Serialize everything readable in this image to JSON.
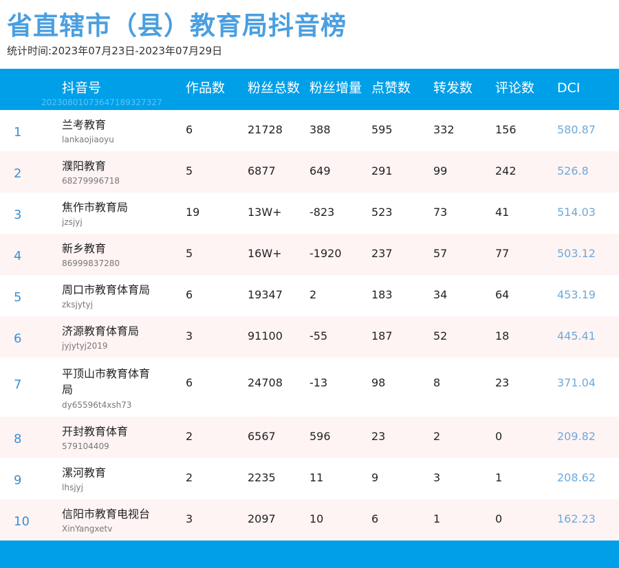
{
  "page": {
    "title": "省直辖市（县）教育局抖音榜",
    "period": "统计时间:2023年07月23日-2023年07月29日"
  },
  "table": {
    "headers": {
      "account": "抖音号",
      "works": "作品数",
      "fans_total": "粉丝总数",
      "fans_growth": "粉丝增量",
      "likes": "点赞数",
      "shares": "转发数",
      "comments": "评论数",
      "dci": "DCI"
    },
    "watermark": "20230801073647189327327",
    "rows": [
      {
        "rank": "1",
        "name": "兰考教育",
        "handle": "lankaojiaoyu",
        "works": "6",
        "fans": "21728",
        "growth": "388",
        "likes": "595",
        "shares": "332",
        "comments": "156",
        "dci": "580.87"
      },
      {
        "rank": "2",
        "name": "濮阳教育",
        "handle": "68279996718",
        "works": "5",
        "fans": "6877",
        "growth": "649",
        "likes": "291",
        "shares": "99",
        "comments": "242",
        "dci": "526.8"
      },
      {
        "rank": "3",
        "name": "焦作市教育局",
        "handle": "jzsjyj",
        "works": "19",
        "fans": "13W+",
        "growth": "-823",
        "likes": "523",
        "shares": "73",
        "comments": "41",
        "dci": "514.03"
      },
      {
        "rank": "4",
        "name": "新乡教育",
        "handle": "86999837280",
        "works": "5",
        "fans": "16W+",
        "growth": "-1920",
        "likes": "237",
        "shares": "57",
        "comments": "77",
        "dci": "503.12"
      },
      {
        "rank": "5",
        "name": "周口市教育体育局",
        "handle": "zksjytyj",
        "works": "6",
        "fans": "19347",
        "growth": "2",
        "likes": "183",
        "shares": "34",
        "comments": "64",
        "dci": "453.19"
      },
      {
        "rank": "6",
        "name": "济源教育体育局",
        "handle": "jyjytyj2019",
        "works": "3",
        "fans": "91100",
        "growth": "-55",
        "likes": "187",
        "shares": "52",
        "comments": "18",
        "dci": "445.41"
      },
      {
        "rank": "7",
        "name": "平顶山市教育体育局",
        "handle": "dy65596t4xsh73",
        "works": "6",
        "fans": "24708",
        "growth": "-13",
        "likes": "98",
        "shares": "8",
        "comments": "23",
        "dci": "371.04"
      },
      {
        "rank": "8",
        "name": "开封教育体育",
        "handle": "579104409",
        "works": "2",
        "fans": "6567",
        "growth": "596",
        "likes": "23",
        "shares": "2",
        "comments": "0",
        "dci": "209.82"
      },
      {
        "rank": "9",
        "name": "漯河教育",
        "handle": "lhsjyj",
        "works": "2",
        "fans": "2235",
        "growth": "11",
        "likes": "9",
        "shares": "3",
        "comments": "1",
        "dci": "208.62"
      },
      {
        "rank": "10",
        "name": "信阳市教育电视台",
        "handle": "XinYangxetv",
        "works": "3",
        "fans": "2097",
        "growth": "10",
        "likes": "6",
        "shares": "1",
        "comments": "0",
        "dci": "162.23"
      }
    ]
  }
}
